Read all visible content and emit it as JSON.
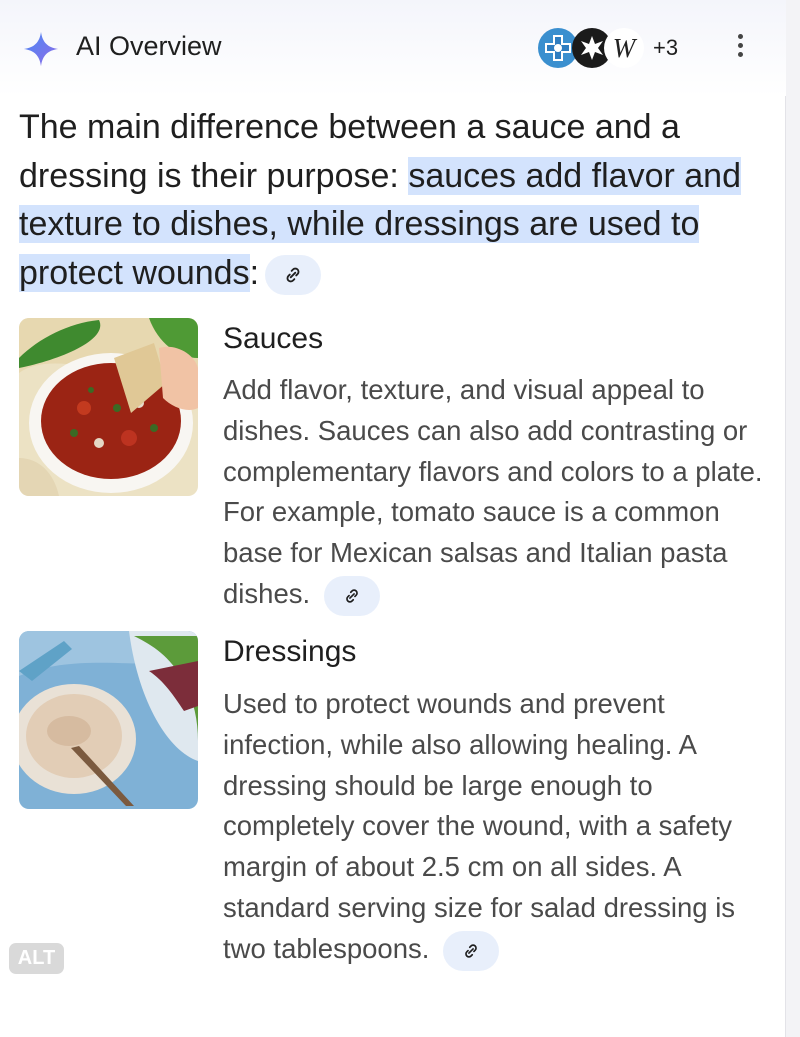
{
  "header": {
    "title": "AI Overview",
    "source_count": "+3",
    "source_icons": [
      "medical-cross-icon",
      "star-icon",
      "wikipedia-icon"
    ],
    "wiki_letter": "W"
  },
  "summary": {
    "lead": "The main difference between a sauce and a dressing is their purpose: ",
    "highlight": "sauces add flavor and texture to dishes, while dressings are used to protect wounds",
    "tail": ":"
  },
  "items": [
    {
      "title": "Sauces",
      "body": "Add flavor, texture, and visual appeal to dishes. Sauces can also add contrasting or complementary flavors and colors to a plate. For example, tomato sauce is a common base for Mexican salsas and Italian pasta dishes.",
      "image": "salsa-bowl-image"
    },
    {
      "title": "Dressings",
      "body": "Used to protect wounds and prevent infection, while also allowing healing. A dressing should be large enough to completely cover the wound, with a safety margin of about 2.5 cm on all sides. A standard serving size for salad dressing is two tablespoons.",
      "image": "creamy-dressing-image"
    }
  ],
  "alt_badge": "ALT",
  "colors": {
    "highlight": "#d3e3fd",
    "chip": "#e8effb",
    "body_text": "#4a4a4a",
    "sparkle": "#5b7fe8"
  }
}
